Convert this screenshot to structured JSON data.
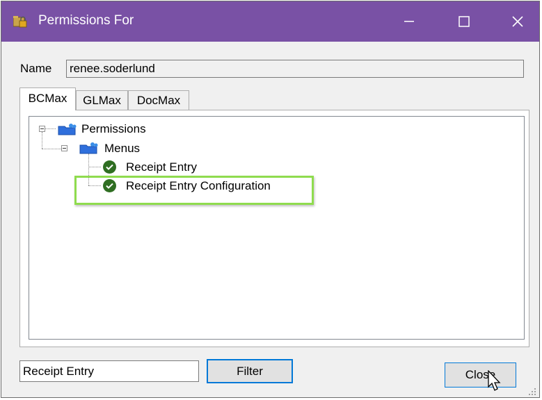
{
  "window": {
    "title": "Permissions For",
    "title_bar_color": "#7951a5",
    "app_icon": "lock-folder-icon"
  },
  "name_field": {
    "label": "Name",
    "value": "renee.soderlund"
  },
  "tabs": [
    {
      "label": "BCMax",
      "active": true
    },
    {
      "label": "GLMax",
      "active": false
    },
    {
      "label": "DocMax",
      "active": false
    }
  ],
  "tree": {
    "root": {
      "label": "Permissions",
      "icon": "folder-people-icon",
      "expanded": true
    },
    "menus": {
      "label": "Menus",
      "icon": "folder-people-icon",
      "expanded": true
    },
    "items": [
      {
        "label": "Receipt Entry",
        "icon": "green-check-icon"
      },
      {
        "label": "Receipt Entry Configuration",
        "icon": "green-check-icon",
        "highlighted": true
      }
    ],
    "highlight_color": "#8fdc4e"
  },
  "filter": {
    "value": "Receipt Entry",
    "button_label": "Filter"
  },
  "close_button_label": "Close"
}
